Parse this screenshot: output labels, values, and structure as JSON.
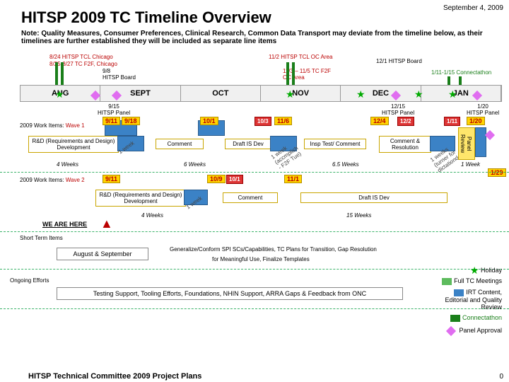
{
  "title": "HITSP 2009 TC Timeline Overview",
  "date": "September 4, 2009",
  "note": "Note: Quality Measures, Consumer Preferences, Clinical Research, Common Data Transport may deviate from the timeline below, as their timelines are further established they will be included as separate line items",
  "months": [
    "AUG",
    "SEPT",
    "OCT",
    "NOV",
    "DEC",
    "JAN"
  ],
  "top_annot": {
    "a1": "8/24 HITSP TCL Chicago",
    "a2": "8/25-8/27 TC F2F, Chicago",
    "a3": "9/8\nHITSP Board",
    "a4": "11/2 HITSP TCL OC Area",
    "a5": "11/3 – 11/5 TC F2F\nOC Area",
    "a6": "12/1 HITSP Board",
    "a7": "1/11-1/15 Connectathon",
    "a8": "9/15\nHITSP Panel",
    "a9": "12/15\nHITSP Panel",
    "a10": "1/20\nHITSP Panel"
  },
  "wave1": {
    "label": "2009 Work Items:",
    "phase": " Wave 1",
    "rnd": "R&D (Requirements and Design) Development",
    "comment": "Comment",
    "draft": "Draft IS Dev",
    "insp": "Insp Test/ Comment",
    "cres": "Comment & Resolution",
    "preview": "Panel Review",
    "t1": "9/11",
    "t2": "9/18",
    "t3": "10/1",
    "t4": "10/3",
    "t5": "11/6",
    "t6": "12/4",
    "t7": "12/2",
    "t8": "1/11",
    "t9": "1/20",
    "w1": "4 Weeks",
    "w2": "6 Weeks",
    "w3": "6.5 Weeks",
    "w4": "1 Week",
    "rot1": "1 week\n(accmplish\n- F2F Tue)",
    "rot2": "1 weeks\n(turner for\ndictationd day)",
    "end": "1/29"
  },
  "wave2": {
    "label": "2009 Work Items:",
    "phase": " Wave 2",
    "rnd": "R&D (Requirements and Design) Development",
    "comment": "Comment",
    "draft": "Draft IS Dev",
    "t1": "9/11",
    "t2": "10/9",
    "t3": "10/1",
    "t4": "11/1",
    "w1": "4 Weeks",
    "w2": "15 Weeks",
    "here": "WE ARE HERE"
  },
  "short": {
    "title": "Short Term Items",
    "augsep": "August & September",
    "desc1": "Generalize/Conform SPI SCs/Capabilities, TC Plans for Transition, Gap Resolution",
    "desc2": "for Meaningful Use, Finalize Templates"
  },
  "ongoing": {
    "title": "Ongoing Efforts",
    "desc": "Testing Support, Tooling Efforts, Foundations, NHIN Support, ARRA Gaps & Feedback from ONC"
  },
  "legend": {
    "holiday": "Holiday",
    "full": "Full TC Meetings",
    "irt": "IRT Content, Editorial and Quality Review",
    "conn": "Connectathon",
    "panel": "Panel Approval"
  },
  "footer": "HITSP Technical Committee 2009 Project Plans",
  "slidenum": "0"
}
